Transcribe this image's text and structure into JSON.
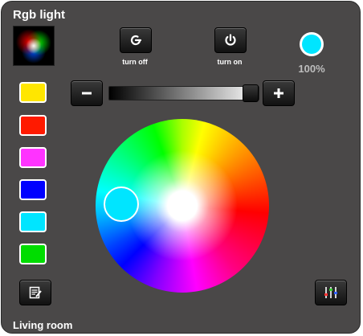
{
  "title": "Rgb light",
  "room": "Living room",
  "buttons": {
    "turn_off_label": "turn off",
    "turn_on_label": "turn on"
  },
  "status": {
    "brightness_text": "100%",
    "brightness_fraction": 1.0,
    "current_color": "#00e5ff"
  },
  "swatches": [
    {
      "color": "#ffe600"
    },
    {
      "color": "#ff1a00"
    },
    {
      "color": "#ff33ff"
    },
    {
      "color": "#0000ff"
    },
    {
      "color": "#00e5ff"
    },
    {
      "color": "#00dd00"
    }
  ],
  "icons": {
    "turn_off": "power-restart-icon",
    "turn_on": "power-icon",
    "minus": "minus-icon",
    "plus": "plus-icon",
    "edit": "edit-note-icon",
    "settings": "equalizer-sliders-icon"
  }
}
